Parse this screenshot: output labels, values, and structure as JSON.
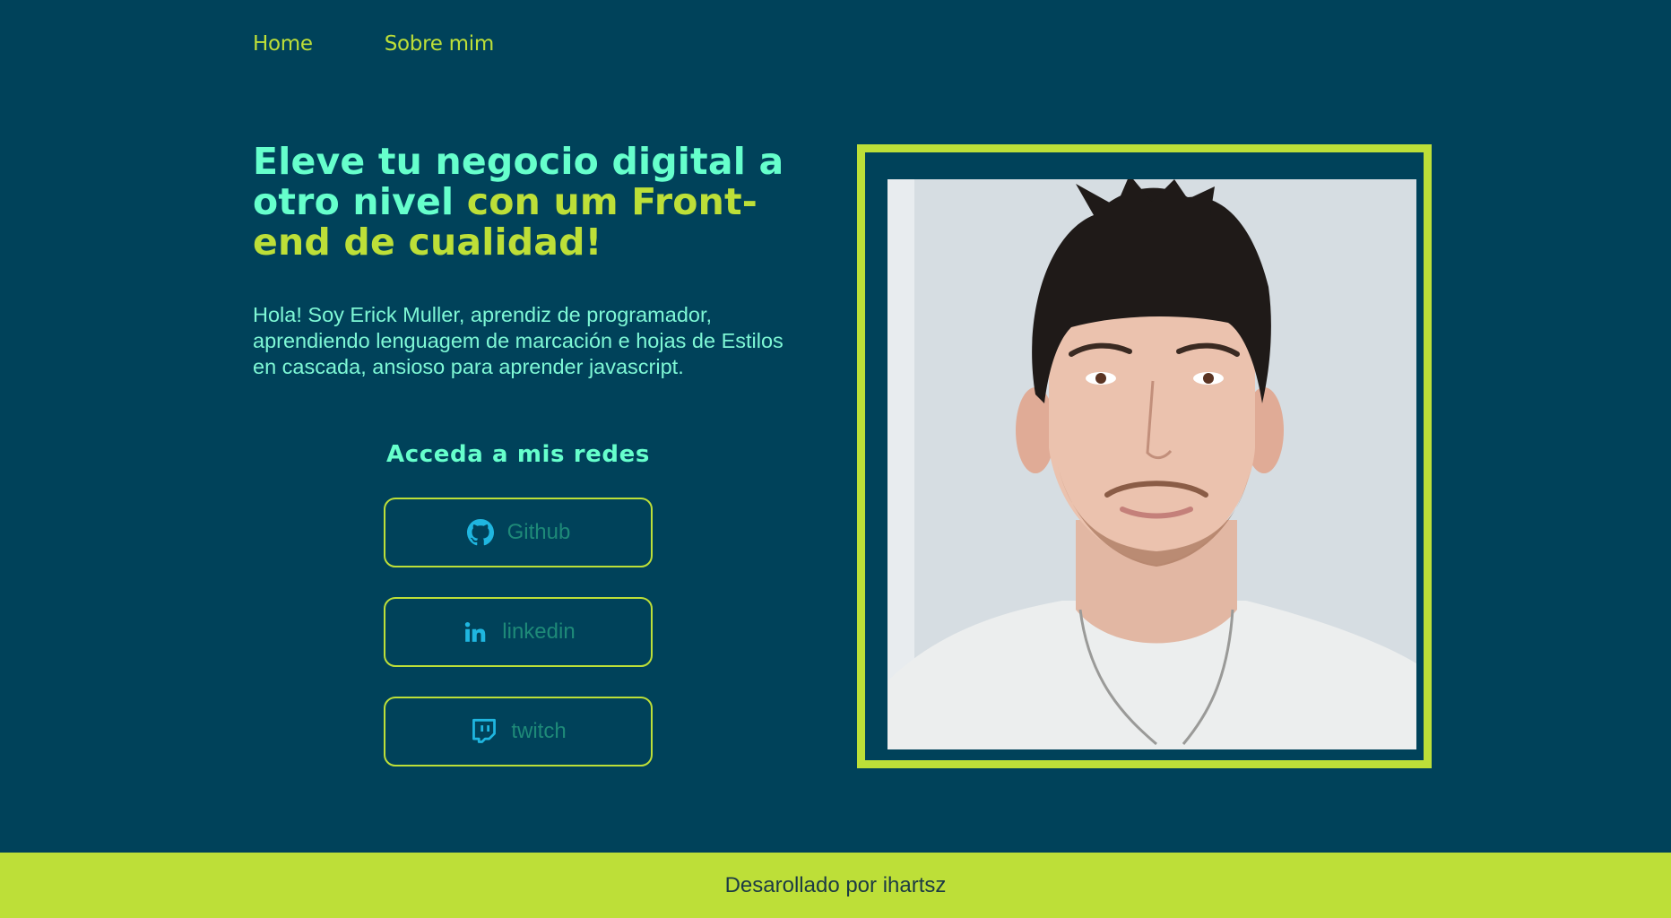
{
  "nav": {
    "items": [
      {
        "label": "Home"
      },
      {
        "label": "Sobre mim"
      }
    ]
  },
  "hero": {
    "title_main": "Eleve tu negocio digital a otro nivel ",
    "title_accent": "con um Front-end de cualidad!",
    "description": "Hola! Soy Erick Muller, aprendiz de programador, aprendiendo lenguagem de marcación e hojas de Estilos en cascada, ansioso para aprender javascript."
  },
  "social": {
    "title": "Acceda a mis redes",
    "buttons": [
      {
        "label": "Github",
        "icon": "github-icon"
      },
      {
        "label": "linkedin",
        "icon": "linkedin-icon"
      },
      {
        "label": "twitch",
        "icon": "twitch-icon"
      }
    ]
  },
  "footer": {
    "text": "Desarollado por ihartsz"
  },
  "colors": {
    "background": "#00425a",
    "accent": "#bddf38",
    "mint": "#66ffcc",
    "icon": "#1fb6e0"
  }
}
